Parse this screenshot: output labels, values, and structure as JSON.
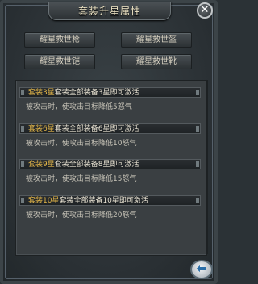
{
  "dialog": {
    "title": "套装升星属性",
    "close_icon": "close-icon",
    "back_icon": "back-arrow-icon"
  },
  "equipment": [
    {
      "name": "耀星救世枪"
    },
    {
      "name": "耀星救世盔"
    },
    {
      "name": "耀星救世铠"
    },
    {
      "name": "耀星救世靴"
    }
  ],
  "sets": [
    {
      "tag": "套装3星",
      "condition": "套装全部装备3星即可激活",
      "effect": "被攻击时，使攻击目标降低5怒气"
    },
    {
      "tag": "套装6星",
      "condition": "套装全部装备6星即可激活",
      "effect": "被攻击时，使攻击目标降低10怒气"
    },
    {
      "tag": "套装9星",
      "condition": "套装全部装备8星即可激活",
      "effect": "被攻击时，使攻击目标降低15怒气"
    },
    {
      "tag": "套装10星",
      "condition": "套装全部装备10星即可激活",
      "effect": "被攻击时，使攻击目标降低20怒气"
    }
  ],
  "colors": {
    "tag": "#e2b548",
    "title": "#f2e8c8"
  }
}
